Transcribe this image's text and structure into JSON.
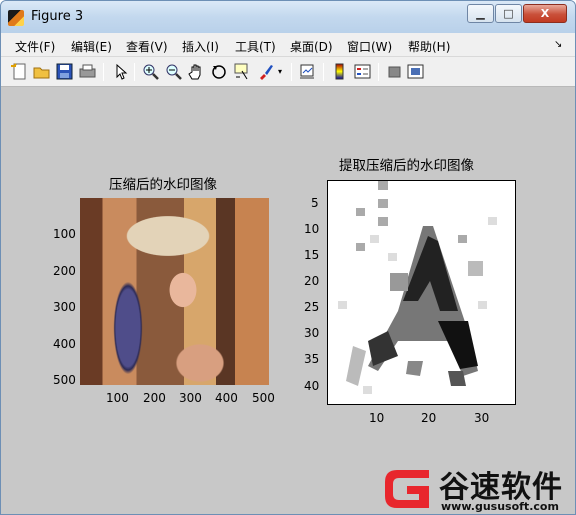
{
  "window": {
    "title": "Figure 3",
    "buttons": {
      "minimize": "▁",
      "maximize": "□",
      "close": "X"
    }
  },
  "menu": {
    "items": [
      {
        "label": "文件(F)"
      },
      {
        "label": "编辑(E)"
      },
      {
        "label": "查看(V)"
      },
      {
        "label": "插入(I)"
      },
      {
        "label": "工具(T)"
      },
      {
        "label": "桌面(D)"
      },
      {
        "label": "窗口(W)"
      },
      {
        "label": "帮助(H)"
      }
    ],
    "pin": "↘"
  },
  "toolbar": {
    "icons": [
      "new-figure-icon",
      "open-file-icon",
      "save-icon",
      "print-icon",
      "pointer-icon",
      "zoom-in-icon",
      "zoom-out-icon",
      "pan-hand-icon",
      "rotate-3d-icon",
      "data-cursor-icon",
      "brush-icon",
      "brush-dropdown-icon",
      "link-plot-icon",
      "colorbar-icon",
      "legend-icon",
      "hide-plot-tools-icon",
      "show-plot-tools-icon"
    ]
  },
  "colors": {
    "canvas": "#c8c8c8",
    "menubar": "#f0f0f0",
    "brand_red": "#e8262d"
  },
  "figure": {
    "left_axes": {
      "title": "压缩后的水印图像",
      "yticks": [
        "100",
        "200",
        "300",
        "400",
        "500"
      ],
      "xticks": [
        "100",
        "200",
        "300",
        "400",
        "500"
      ]
    },
    "right_axes": {
      "title": "提取压缩后的水印图像",
      "yticks": [
        "5",
        "10",
        "15",
        "20",
        "25",
        "30",
        "35",
        "40"
      ],
      "xticks": [
        "10",
        "20",
        "30"
      ]
    }
  },
  "watermark": {
    "name": "谷速软件",
    "url": "www.gususoft.com"
  }
}
